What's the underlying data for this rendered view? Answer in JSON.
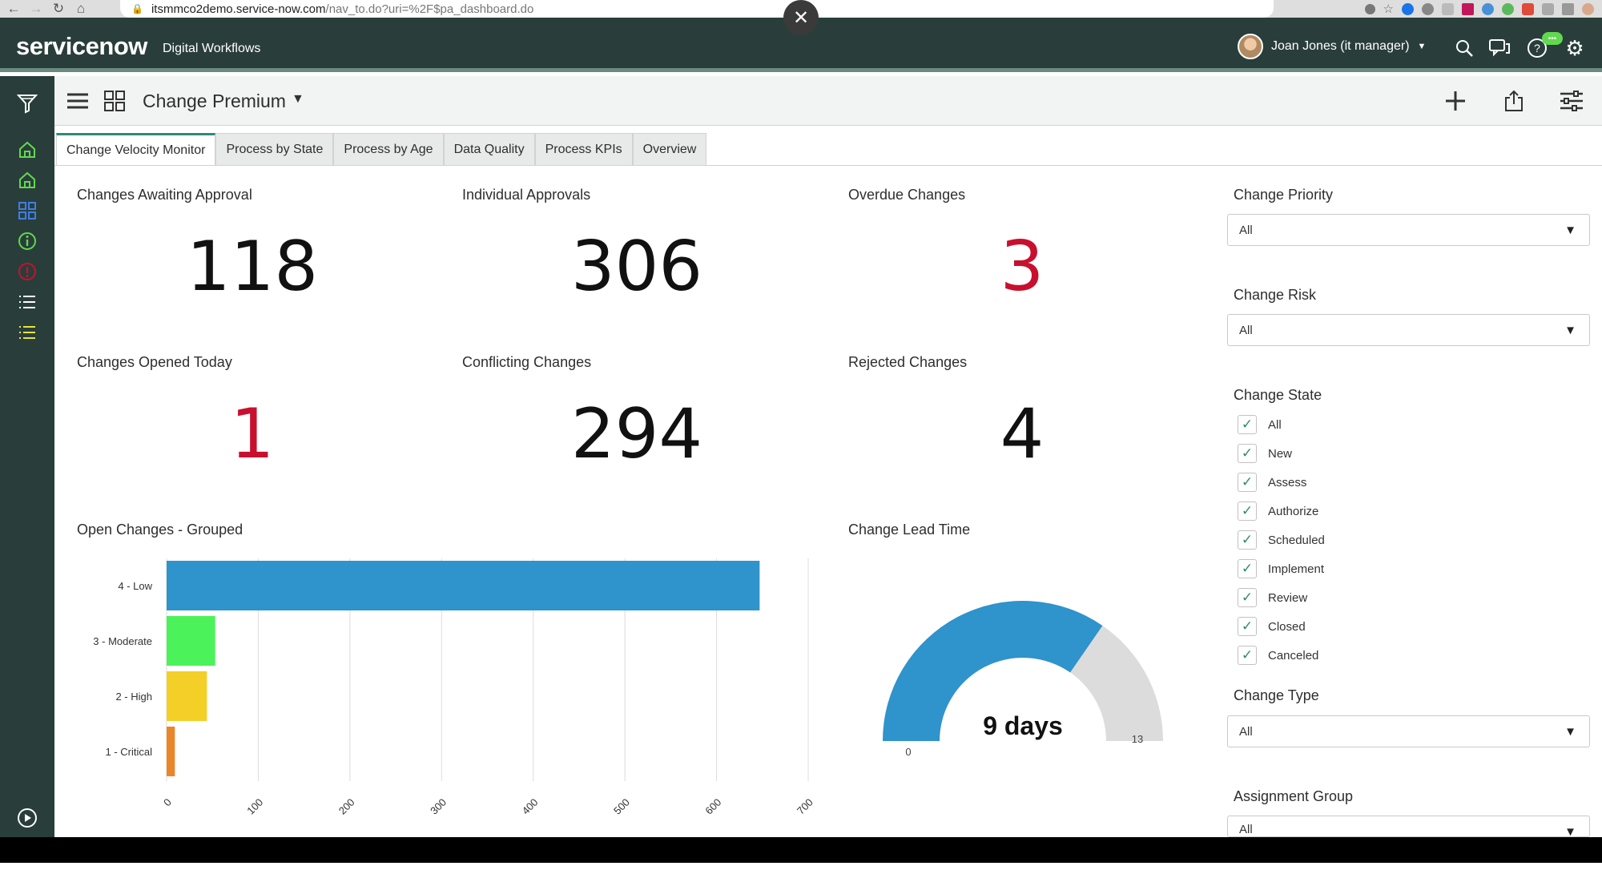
{
  "browser": {
    "url_host": "itsmmco2demo.service-now.com",
    "url_path": "/nav_to.do?uri=%2F$pa_dashboard.do"
  },
  "header": {
    "logo": "servicenow",
    "product": "Digital Workflows",
    "user_name": "Joan Jones (it manager)",
    "chat_badge": "•••"
  },
  "dashboard": {
    "title": "Change Premium"
  },
  "tabs": [
    {
      "label": "Change Velocity Monitor",
      "active": true
    },
    {
      "label": "Process by State"
    },
    {
      "label": "Process by Age"
    },
    {
      "label": "Data Quality"
    },
    {
      "label": "Process KPIs"
    },
    {
      "label": "Overview"
    }
  ],
  "tiles": {
    "awaiting_approval": {
      "title": "Changes Awaiting Approval",
      "value": "118"
    },
    "individual_approvals": {
      "title": "Individual Approvals",
      "value": "306"
    },
    "overdue": {
      "title": "Overdue Changes",
      "value": "3",
      "color": "#c8102e"
    },
    "opened_today": {
      "title": "Changes Opened Today",
      "value": "1",
      "color": "#c8102e"
    },
    "conflicting": {
      "title": "Conflicting Changes",
      "value": "294"
    },
    "rejected": {
      "title": "Rejected Changes",
      "value": "4"
    }
  },
  "widgets": {
    "open_changes_title": "Open Changes - Grouped",
    "lead_time_title": "Change Lead Time"
  },
  "chart_data": [
    {
      "type": "bar",
      "orientation": "horizontal",
      "title": "Open Changes - Grouped",
      "categories": [
        "4 - Low",
        "3 - Moderate",
        "2 - High",
        "1 - Critical"
      ],
      "values": [
        647,
        53,
        44,
        9
      ],
      "colors": [
        "#2f93cc",
        "#4cf25a",
        "#f3cf28",
        "#e9862a"
      ],
      "xlim": [
        0,
        700
      ],
      "ticks": [
        "0",
        "100",
        "200",
        "300",
        "400",
        "500",
        "600",
        "700"
      ],
      "grid": true
    },
    {
      "type": "gauge",
      "title": "Change Lead Time",
      "value": 9,
      "min": 0,
      "max": 13,
      "value_label": "9 days",
      "min_label": "0",
      "max_label": "13",
      "fill_color": "#2f93cc",
      "track_color": "#dcdcdc"
    }
  ],
  "filters": {
    "priority": {
      "title": "Change Priority",
      "value": "All"
    },
    "risk": {
      "title": "Change Risk",
      "value": "All"
    },
    "state": {
      "title": "Change State",
      "options": [
        "All",
        "New",
        "Assess",
        "Authorize",
        "Scheduled",
        "Implement",
        "Review",
        "Closed",
        "Canceled"
      ]
    },
    "type": {
      "title": "Change Type",
      "value": "All"
    },
    "group": {
      "title": "Assignment Group",
      "value": "All"
    }
  },
  "colors": {
    "header_bg": "#293e3b",
    "accent": "#2f8a76",
    "alert_red": "#c8102e"
  }
}
